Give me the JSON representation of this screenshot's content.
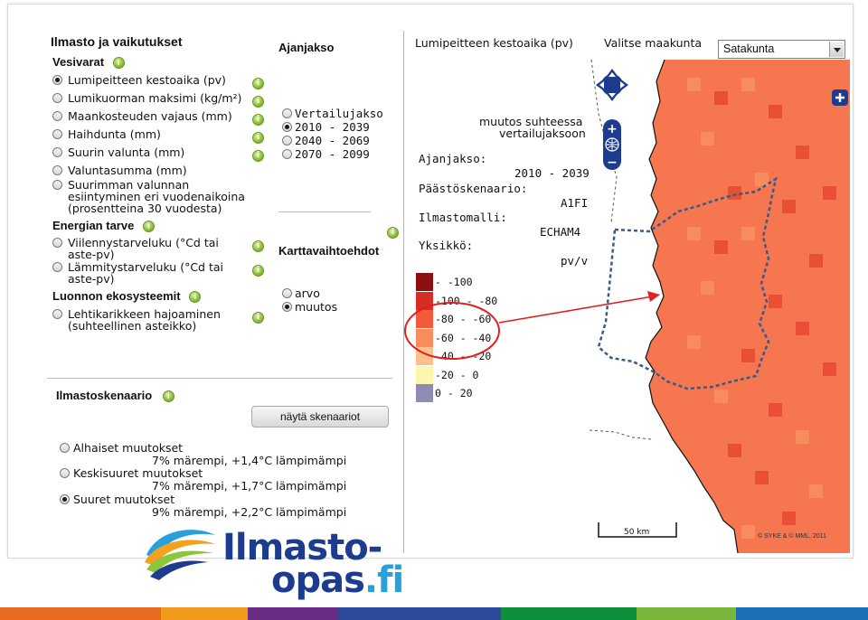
{
  "left": {
    "title": "Ilmasto ja vaikutukset",
    "sections": [
      {
        "heading": "Vesivarat",
        "options": [
          {
            "label": "Lumipeitteen kestoaika (pv)",
            "selected": true
          },
          {
            "label": "Lumikuorman maksimi (kg/m²)",
            "selected": false
          },
          {
            "label": "Maankosteuden vajaus (mm)",
            "selected": false
          },
          {
            "label": "Haihdunta (mm)",
            "selected": false
          },
          {
            "label": "Suurin valunta (mm)",
            "selected": false
          },
          {
            "label": "Valuntasumma (mm)",
            "selected": false
          },
          {
            "label_lines": [
              "Suurimman valunnan",
              "esiintyminen eri vuodenaikoina",
              "(prosentteina 30 vuodesta)"
            ],
            "selected": false
          }
        ]
      },
      {
        "heading": "Energian tarve",
        "options": [
          {
            "label_lines": [
              "Viilennystarveluku (°Cd tai",
              "aste-pv)"
            ],
            "selected": false
          },
          {
            "label_lines": [
              "Lämmitystarveluku (°Cd tai",
              "aste-pv)"
            ],
            "selected": false
          }
        ]
      },
      {
        "heading": "Luonnon ekosysteemit",
        "options": [
          {
            "label_lines": [
              "Lehtikarikkeen hajoaminen",
              "(suhteellinen asteikko)"
            ],
            "selected": false
          }
        ]
      }
    ],
    "period": {
      "heading": "Ajanjakso",
      "options": [
        "Vertailujakso",
        "2010 - 2039",
        "2040 - 2069",
        "2070 - 2099"
      ],
      "selected_index": 1
    },
    "map_options": {
      "heading": "Karttavaihtoehdot",
      "options": [
        "arvo",
        "muutos"
      ],
      "selected_index": 1
    },
    "scenarios": {
      "heading": "Ilmastoskenaario",
      "button_label": "näytä skenaariot",
      "items": [
        {
          "label": "Alhaiset muutokset",
          "desc": "7% märempi, +1,4°C lämpimämpi",
          "selected": false
        },
        {
          "label": "Keskisuuret muutokset",
          "desc": "7% märempi, +1,7°C lämpimämpi",
          "selected": false
        },
        {
          "label": "Suuret muutokset",
          "desc": "9% märempi, +2,2°C lämpimämpi",
          "selected": true
        }
      ]
    },
    "logo": {
      "line1": "Ilmasto-",
      "line2": "opas",
      "line2_suffix": ".fi"
    }
  },
  "map": {
    "title": "Lumipeitteen kestoaika (pv)",
    "region_label": "Valitse maakunta",
    "region_value": "Satakunta",
    "info": {
      "change_line1": "muutos suhteessa",
      "change_line2": "vertailujaksoon",
      "period_label": "Ajanjakso:",
      "period_value": "2010 - 2039",
      "scenario_label": "Päästöskenaario:",
      "scenario_value": "A1FI",
      "model_label": "Ilmastomalli:",
      "model_value": "ECHAM4",
      "unit_label": "Yksikkö:",
      "unit_value": "pv/v"
    },
    "legend": [
      {
        "label": "- -100",
        "color": "#8b0f0f"
      },
      {
        "label": "-100 - -80",
        "color": "#d72d24"
      },
      {
        "label": "-80 - -60",
        "color": "#f35a3b"
      },
      {
        "label": "-60 - -40",
        "color": "#f98c5c"
      },
      {
        "label": "-40 - -20",
        "color": "#fbc08a"
      },
      {
        "label": "-20 - 0",
        "color": "#fdf6ad"
      },
      {
        "label": "0 - 20",
        "color": "#8c8cb4"
      }
    ],
    "scale_label": "50 km",
    "copyright": "© SYKE & © MML, 2011"
  },
  "colors": {
    "map_base": "#f6764f",
    "map_dark": "#e94f34",
    "map_light": "#fa9468",
    "border_dash": "#3a5a86",
    "annotation": "#e0201e",
    "logo_blue": "#1d3c8f",
    "logo_cyan": "#27a1dc"
  },
  "strip_colors": [
    "#ea6a20",
    "#f29a1e",
    "#6a2b85",
    "#2b4a9b",
    "#0d8f3b",
    "#7ab63a",
    "#1b6fb7"
  ]
}
